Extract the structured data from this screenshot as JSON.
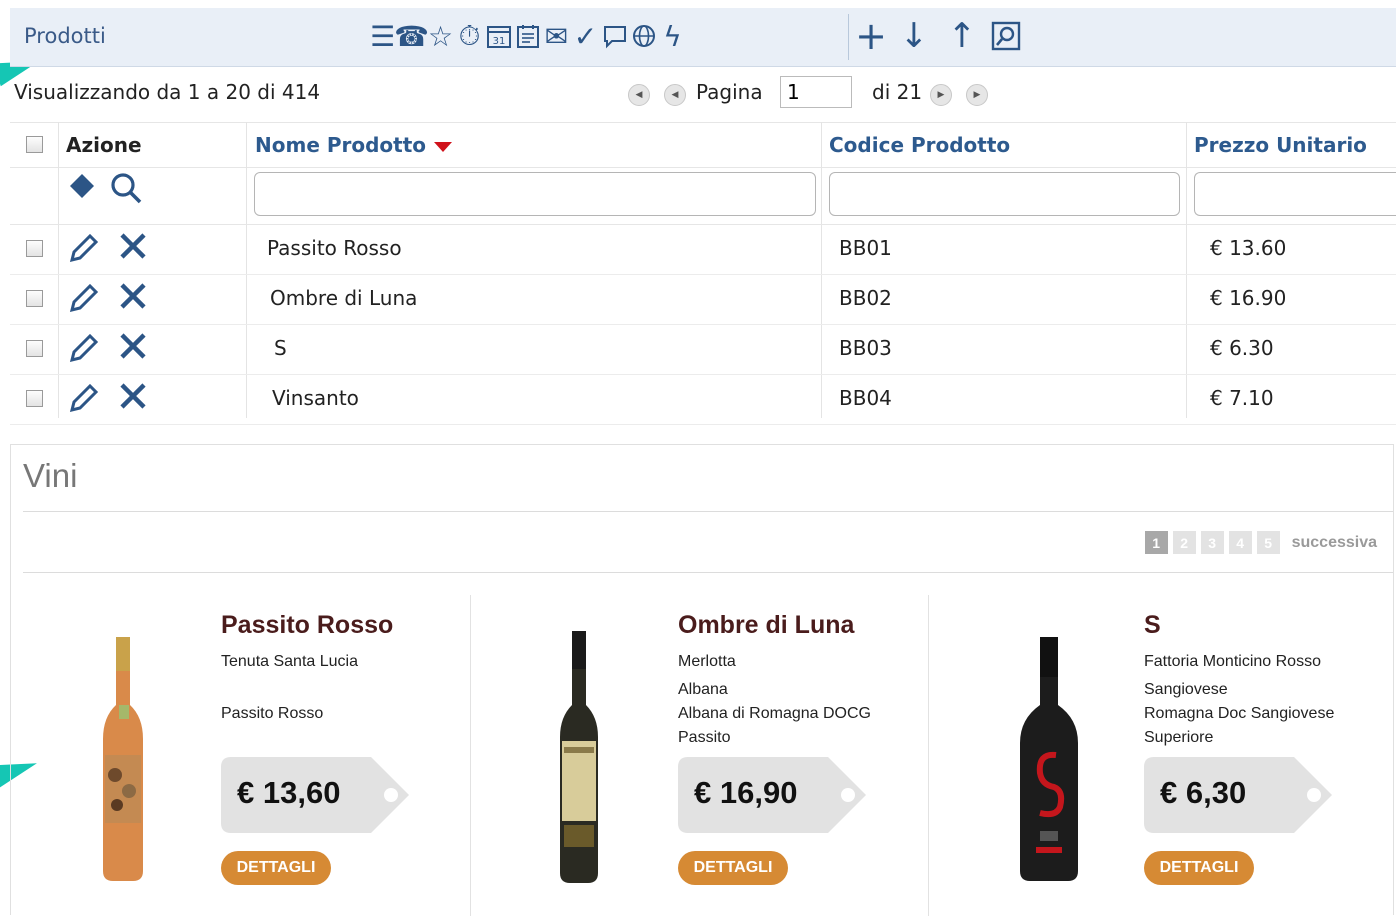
{
  "header": {
    "title": "Prodotti",
    "toolbar_icons": [
      "list-icon",
      "phone-icon",
      "star-icon",
      "stopwatch-icon",
      "calendar-icon",
      "notepad-icon",
      "mail-icon",
      "check-icon",
      "comment-icon",
      "globe-icon",
      "lightning-icon",
      "plus-icon",
      "arrow-down-icon",
      "arrow-up-icon",
      "search-doc-icon"
    ]
  },
  "pager": {
    "showing": "Visualizzando da 1 a 20 di 414",
    "page_label": "Pagina",
    "page_value": "1",
    "of_label": "di 21"
  },
  "grid": {
    "columns": {
      "action": "Azione",
      "name": "Nome Prodotto",
      "code": "Codice Prodotto",
      "price": "Prezzo Unitario"
    },
    "rows": [
      {
        "name": "Passito Rosso",
        "code": "BB01",
        "price": "€ 13.60"
      },
      {
        "name": "Ombre di Luna",
        "code": "BB02",
        "price": "€ 16.90"
      },
      {
        "name": "S",
        "code": "BB03",
        "price": "€ 6.30"
      },
      {
        "name": "Vinsanto",
        "code": "BB04",
        "price": "€ 7.10"
      }
    ]
  },
  "panel": {
    "title": "Vini",
    "pages": [
      "1",
      "2",
      "3",
      "4",
      "5"
    ],
    "next_label": "successiva",
    "cards": [
      {
        "title": "Passito Rosso",
        "l1": "Tenuta Santa Lucia",
        "l2": "",
        "l3": "Passito Rosso",
        "l4": "",
        "price": "€ 13,60",
        "button": "DETTAGLI"
      },
      {
        "title": "Ombre di Luna",
        "l1": "Merlotta",
        "l2": "Albana",
        "l3": "Albana di Romagna DOCG",
        "l4": "Passito",
        "price": "€ 16,90",
        "button": "DETTAGLI"
      },
      {
        "title": "S",
        "l1": "Fattoria Monticino Rosso",
        "l2": "Sangiovese",
        "l3": "Romagna Doc Sangiovese",
        "l4": "Superiore",
        "price": "€ 6,30",
        "button": "DETTAGLI"
      }
    ]
  },
  "colors": {
    "accent": "#2d5a8e",
    "header_bg": "#e9eff7",
    "button": "#d68a34",
    "sort_arrow": "#d0121b",
    "marker": "#15c6b4"
  }
}
